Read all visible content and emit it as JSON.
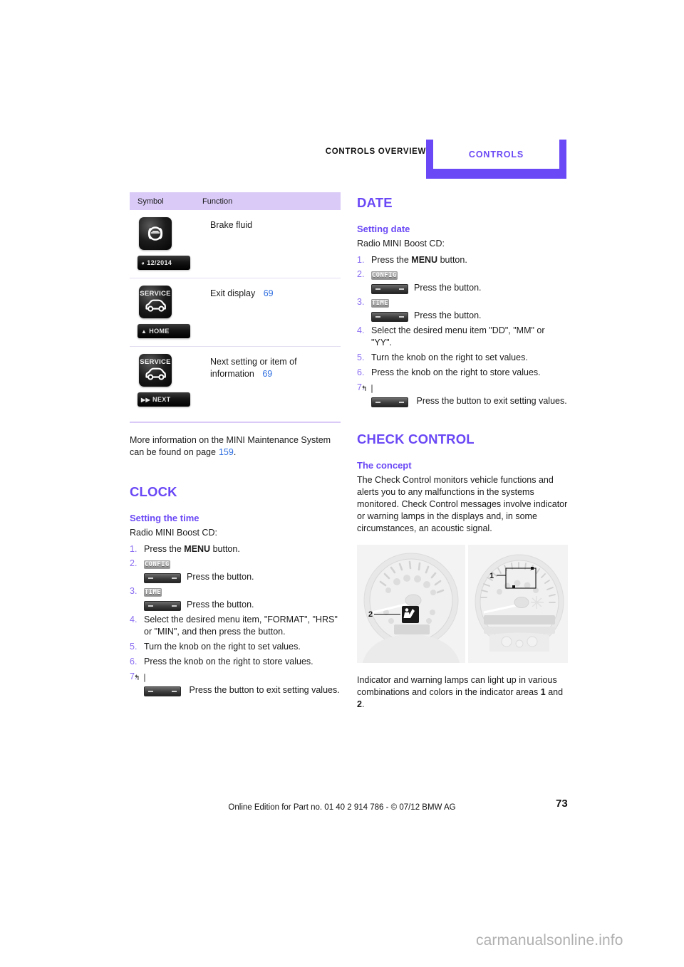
{
  "header": {
    "chapter": "CONTROLS OVERVIEW",
    "tab": "CONTROLS",
    "accent_color": "#6a48f5"
  },
  "symbol_table": {
    "columns": [
      "Symbol",
      "Function"
    ],
    "rows": [
      {
        "icon_name": "brake-fluid-icon",
        "icon_label": "",
        "icon_bar_text": "12/2014",
        "icon_bar_glyph": "clock",
        "function": "Brake fluid",
        "page_ref": ""
      },
      {
        "icon_name": "service-car-icon",
        "icon_label": "SERVICE",
        "icon_bar_text": "HOME",
        "icon_bar_glyph": "up-triangle",
        "function": "Exit display",
        "page_ref": "69"
      },
      {
        "icon_name": "service-car-icon",
        "icon_label": "SERVICE",
        "icon_bar_text": "NEXT",
        "icon_bar_glyph": "double-right",
        "function": "Next setting or item of information",
        "page_ref": "69"
      }
    ]
  },
  "maintenance_note": {
    "text_before": "More information on the MINI Maintenance System can be found on page",
    "page_ref": "159",
    "text_after": "."
  },
  "clock": {
    "title": "CLOCK",
    "subtitle": "Setting the time",
    "intro": "Radio MINI Boost CD:",
    "steps": [
      {
        "num": "1.",
        "kind": "text",
        "text_pre": "Press the ",
        "bold": "MENU",
        "text_post": " button."
      },
      {
        "num": "2.",
        "kind": "button",
        "button_label": "CONFIG",
        "after": "Press the button."
      },
      {
        "num": "3.",
        "kind": "button",
        "button_label": "TIME",
        "after": "Press the button."
      },
      {
        "num": "4.",
        "kind": "text",
        "text_pre": "Select the desired menu item, \"FORMAT\", \"HRS\" or \"MIN\", and then press the button.",
        "bold": "",
        "text_post": ""
      },
      {
        "num": "5.",
        "kind": "text",
        "text_pre": "Turn the knob on the right to set values.",
        "bold": "",
        "text_post": ""
      },
      {
        "num": "6.",
        "kind": "text",
        "text_pre": "Press the knob on the right to store values.",
        "bold": "",
        "text_post": ""
      },
      {
        "num": "7.",
        "kind": "button",
        "button_label": "",
        "after": "Press the button to exit setting values."
      }
    ]
  },
  "date": {
    "title": "DATE",
    "subtitle": "Setting date",
    "intro": "Radio MINI Boost CD:",
    "steps": [
      {
        "num": "1.",
        "kind": "text",
        "text_pre": "Press the ",
        "bold": "MENU",
        "text_post": " button."
      },
      {
        "num": "2.",
        "kind": "button",
        "button_label": "CONFIG",
        "after": "Press the button."
      },
      {
        "num": "3.",
        "kind": "button",
        "button_label": "TIME",
        "after": "Press the button."
      },
      {
        "num": "4.",
        "kind": "text",
        "text_pre": "Select the desired menu item \"DD\", \"MM\" or \"YY\".",
        "bold": "",
        "text_post": ""
      },
      {
        "num": "5.",
        "kind": "text",
        "text_pre": "Turn the knob on the right to set values.",
        "bold": "",
        "text_post": ""
      },
      {
        "num": "6.",
        "kind": "text",
        "text_pre": "Press the knob on the right to store values.",
        "bold": "",
        "text_post": ""
      },
      {
        "num": "7.",
        "kind": "button",
        "button_label": "",
        "after": "Press the button to exit setting values."
      }
    ]
  },
  "check_control": {
    "title": "CHECK CONTROL",
    "subtitle": "The concept",
    "paragraph": "The Check Control monitors vehicle functions and alerts you to any malfunctions in the systems monitored. Check Control messages involve indicator or warning lamps in the displays and, in some circumstances, an acoustic signal.",
    "figure": {
      "callout_1": "1",
      "callout_2": "2",
      "alt": "Two instrument cluster dials with indicator areas marked 1 and 2"
    },
    "caption_pre": "Indicator and warning lamps can light up in various combinations and colors in the indicator areas ",
    "caption_b1": "1",
    "caption_mid": " and ",
    "caption_b2": "2",
    "caption_post": "."
  },
  "footer": {
    "edition_line": "Online Edition for Part no. 01 40 2 914 786 - © 07/12 BMW AG",
    "page_number": "73",
    "watermark": "carmanualsonline.info"
  }
}
